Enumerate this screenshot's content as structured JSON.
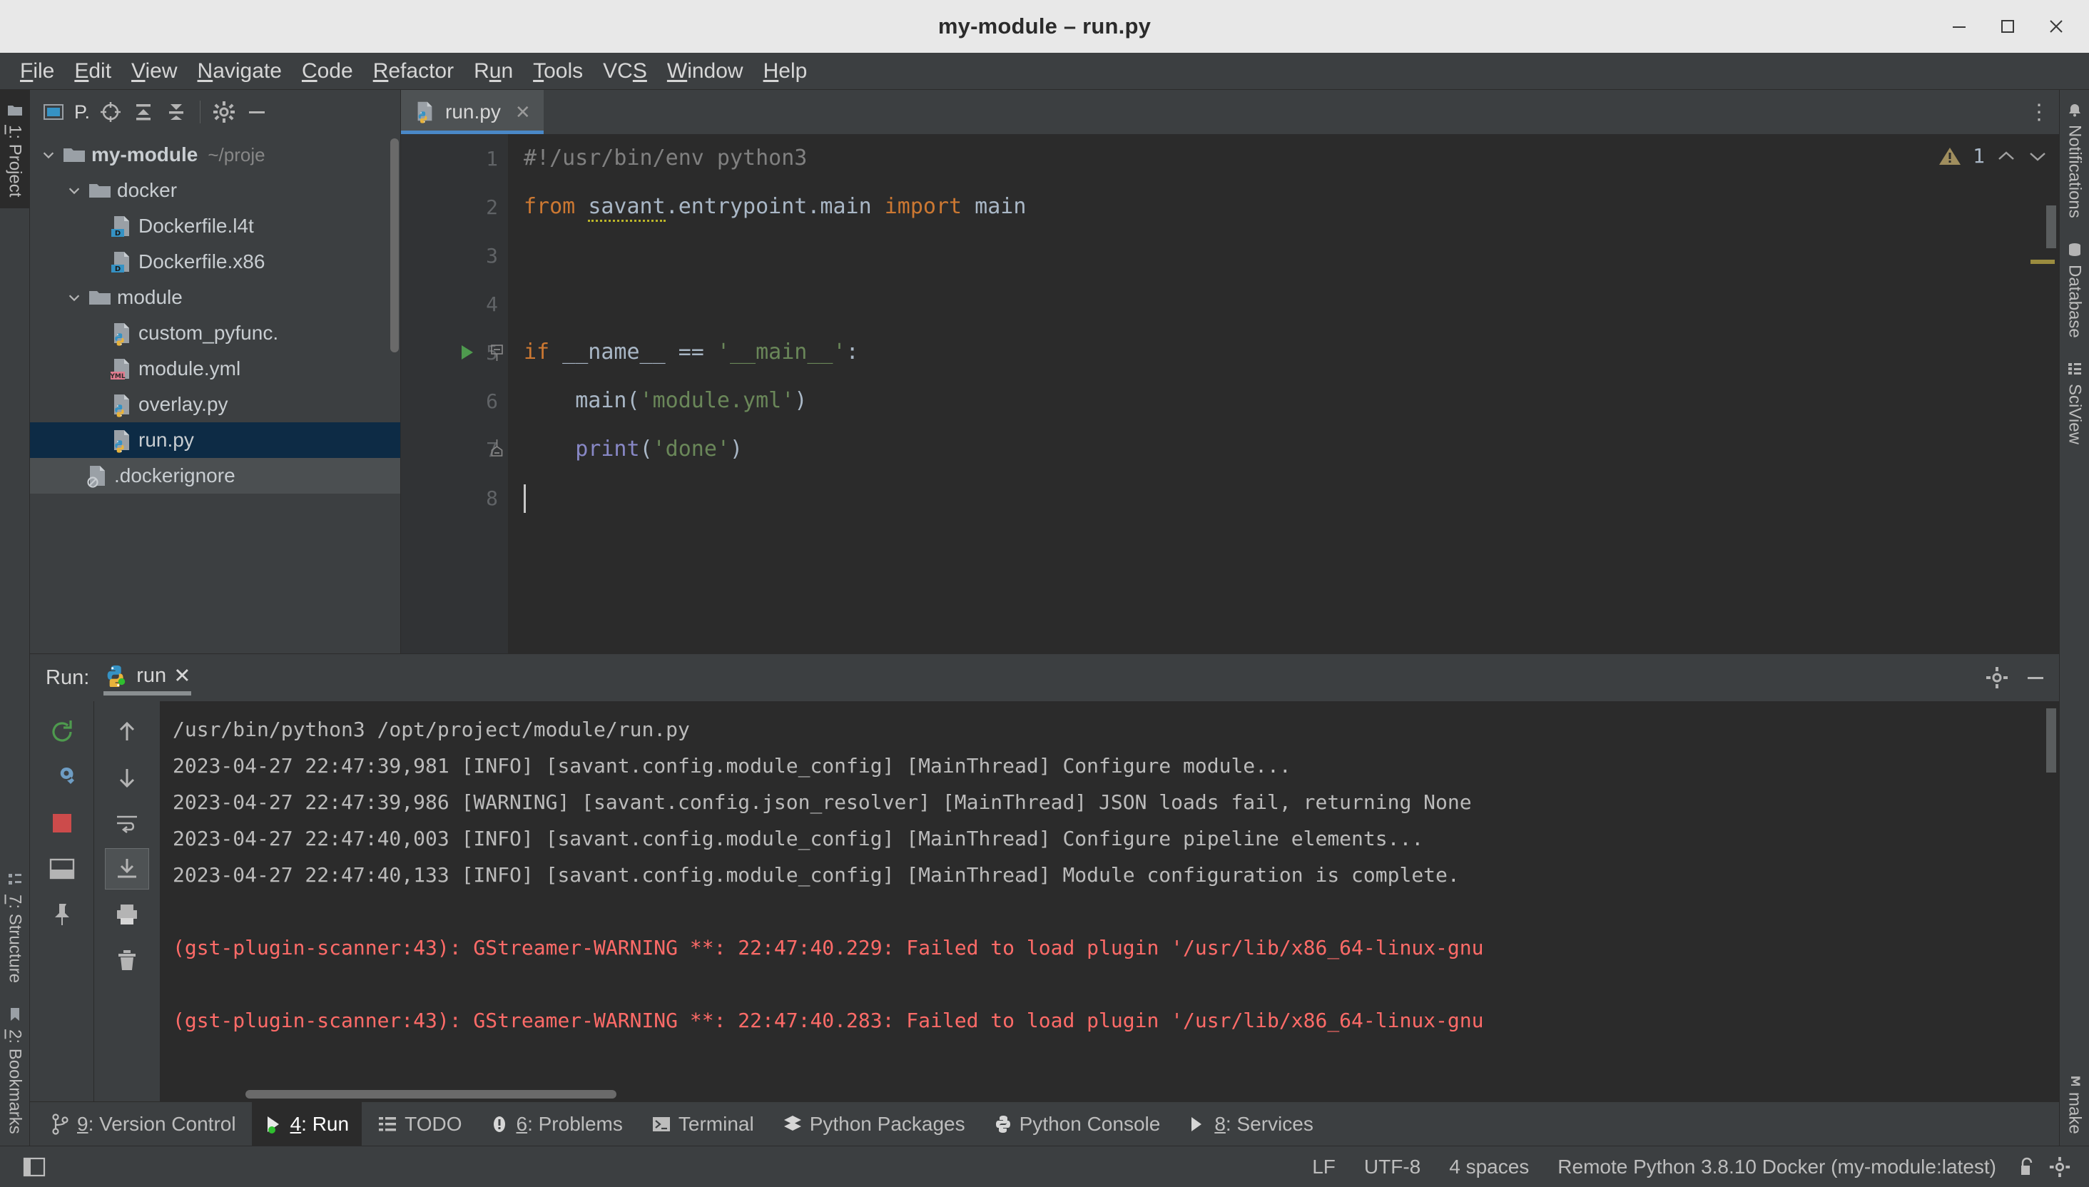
{
  "window": {
    "title": "my-module – run.py",
    "minimize_label": "—",
    "maximize_label": "❐",
    "close_label": "✕"
  },
  "menubar": {
    "items": [
      {
        "label": "File",
        "mnemonic": "F"
      },
      {
        "label": "Edit",
        "mnemonic": "E"
      },
      {
        "label": "View",
        "mnemonic": "V"
      },
      {
        "label": "Navigate",
        "mnemonic": "N"
      },
      {
        "label": "Code",
        "mnemonic": "C"
      },
      {
        "label": "Refactor",
        "mnemonic": "R"
      },
      {
        "label": "Run",
        "mnemonic": "u"
      },
      {
        "label": "Tools",
        "mnemonic": "T"
      },
      {
        "label": "VCS",
        "mnemonic": "S"
      },
      {
        "label": "Window",
        "mnemonic": "W"
      },
      {
        "label": "Help",
        "mnemonic": "H"
      }
    ]
  },
  "left_stripe": {
    "top": [
      {
        "label": "1: Project",
        "icon": "project-folder-icon",
        "active": true
      }
    ],
    "bottom": [
      {
        "label": "7: Structure",
        "icon": "structure-icon",
        "active": false
      },
      {
        "label": "2: Bookmarks",
        "icon": "bookmark-icon",
        "active": false
      }
    ]
  },
  "right_stripe": {
    "top": [
      {
        "label": "Notifications",
        "icon": "bell-icon"
      },
      {
        "label": "Database",
        "icon": "database-icon"
      },
      {
        "label": "SciView",
        "icon": "sciview-icon"
      }
    ],
    "bottom": [
      {
        "label": "make",
        "icon": "make-icon"
      }
    ]
  },
  "project_panel": {
    "title": "P.",
    "toolbar": [
      {
        "name": "select-opened-file-icon",
        "tooltip": "Select Opened File"
      },
      {
        "name": "collapse-all-icon",
        "tooltip": "Expand All"
      },
      {
        "name": "expand-all-icon",
        "tooltip": "Collapse All"
      },
      {
        "name": "settings-gear-icon",
        "tooltip": "Options"
      },
      {
        "name": "hide-icon",
        "tooltip": "Hide"
      }
    ],
    "tree": [
      {
        "label": "my-module",
        "path": "~/proje",
        "icon": "folder-icon",
        "indent": 0,
        "expanded": true,
        "bold": true,
        "state": "normal"
      },
      {
        "label": "docker",
        "path": "",
        "icon": "folder-icon",
        "indent": 1,
        "expanded": true,
        "bold": false,
        "state": "normal"
      },
      {
        "label": "Dockerfile.l4t",
        "path": "",
        "icon": "dockerfile-icon",
        "indent": 2,
        "expanded": null,
        "bold": false,
        "state": "normal"
      },
      {
        "label": "Dockerfile.x86",
        "path": "",
        "icon": "dockerfile-icon",
        "indent": 2,
        "expanded": null,
        "bold": false,
        "state": "normal"
      },
      {
        "label": "module",
        "path": "",
        "icon": "folder-icon",
        "indent": 1,
        "expanded": true,
        "bold": false,
        "state": "normal"
      },
      {
        "label": "custom_pyfunc.",
        "path": "",
        "icon": "python-file-icon",
        "indent": 2,
        "expanded": null,
        "bold": false,
        "state": "normal"
      },
      {
        "label": "module.yml",
        "path": "",
        "icon": "yml-file-icon",
        "indent": 2,
        "expanded": null,
        "bold": false,
        "state": "normal"
      },
      {
        "label": "overlay.py",
        "path": "",
        "icon": "python-file-icon",
        "indent": 2,
        "expanded": null,
        "bold": false,
        "state": "normal"
      },
      {
        "label": "run.py",
        "path": "",
        "icon": "python-file-icon",
        "indent": 2,
        "expanded": null,
        "bold": false,
        "state": "selected"
      },
      {
        "label": ".dockerignore",
        "path": "",
        "icon": "ignore-file-icon",
        "indent": 1,
        "expanded": null,
        "bold": false,
        "state": "hovered"
      }
    ]
  },
  "editor": {
    "tab": {
      "label": "run.py",
      "icon": "python-file-icon",
      "close": "✕"
    },
    "more_label": "⋮",
    "warning_count": "1",
    "warning_up": "⌃",
    "warning_down": "⌄",
    "lines": [
      {
        "num": "1",
        "marker": "none"
      },
      {
        "num": "2",
        "marker": "none"
      },
      {
        "num": "3",
        "marker": "none"
      },
      {
        "num": "4",
        "marker": "none"
      },
      {
        "num": "5",
        "marker": "run"
      },
      {
        "num": "6",
        "marker": "none"
      },
      {
        "num": "7",
        "marker": "fold-end"
      },
      {
        "num": "8",
        "marker": "none"
      }
    ],
    "code": {
      "l1_comment": "#!/usr/bin/env python3",
      "l2_kw_from": "from",
      "l2_mod": "savant",
      "l2_rest": ".entrypoint.main ",
      "l2_kw_import": "import",
      "l2_name": " main",
      "l5_kw_if": "if",
      "l5_name": " __name__ == ",
      "l5_str": "'__main__'",
      "l5_colon": ":",
      "l6_fn": "main",
      "l6_open": "(",
      "l6_str": "'module.yml'",
      "l6_close": ")",
      "l7_fn": "print",
      "l7_open": "(",
      "l7_str": "'done'",
      "l7_close": ")"
    }
  },
  "run_panel": {
    "label": "Run:",
    "tab_label": "run",
    "tab_icon": "python-run-icon",
    "tab_close": "✕",
    "settings_icon": "settings-gear-icon",
    "minimize_icon": "minimize-icon",
    "toolbar_left": [
      {
        "name": "rerun-icon",
        "tooltip": "Rerun"
      },
      {
        "name": "wrench-icon",
        "tooltip": "Modify Run Configuration"
      },
      {
        "name": "stop-icon",
        "tooltip": "Stop"
      },
      {
        "name": "layout-icon",
        "tooltip": "Layout Settings"
      },
      {
        "name": "pin-icon",
        "tooltip": "Pin Tab"
      }
    ],
    "toolbar_right": [
      {
        "name": "arrow-up-icon",
        "tooltip": "Up the Stack Trace"
      },
      {
        "name": "arrow-down-icon",
        "tooltip": "Down the Stack Trace"
      },
      {
        "name": "soft-wrap-icon",
        "tooltip": "Soft-Wrap"
      },
      {
        "name": "scroll-to-end-icon",
        "tooltip": "Scroll to End"
      },
      {
        "name": "print-icon",
        "tooltip": "Print"
      },
      {
        "name": "trash-icon",
        "tooltip": "Clear All"
      }
    ],
    "console": [
      {
        "text": "/usr/bin/python3 /opt/project/module/run.py",
        "color": "normal"
      },
      {
        "text": "2023-04-27 22:47:39,981 [INFO] [savant.config.module_config] [MainThread] Configure module...",
        "color": "normal"
      },
      {
        "text": "2023-04-27 22:47:39,986 [WARNING] [savant.config.json_resolver] [MainThread] JSON loads fail, returning None",
        "color": "normal"
      },
      {
        "text": "2023-04-27 22:47:40,003 [INFO] [savant.config.module_config] [MainThread] Configure pipeline elements...",
        "color": "normal"
      },
      {
        "text": "2023-04-27 22:47:40,133 [INFO] [savant.config.module_config] [MainThread] Module configuration is complete.",
        "color": "normal"
      },
      {
        "text": "",
        "color": "normal"
      },
      {
        "text": "(gst-plugin-scanner:43): GStreamer-WARNING **: 22:47:40.229: Failed to load plugin '/usr/lib/x86_64-linux-gnu",
        "color": "red"
      },
      {
        "text": "",
        "color": "normal"
      },
      {
        "text": "(gst-plugin-scanner:43): GStreamer-WARNING **: 22:47:40.283: Failed to load plugin '/usr/lib/x86_64-linux-gnu",
        "color": "red"
      }
    ]
  },
  "bottom_bar": {
    "tabs": [
      {
        "label": "9: Version Control",
        "mnemonic": "9",
        "icon": "vcs-branch-icon",
        "active": false
      },
      {
        "label": "4: Run",
        "mnemonic": "4",
        "icon": "run-play-icon",
        "active": true
      },
      {
        "label": "TODO",
        "mnemonic": "",
        "icon": "todo-list-icon",
        "active": false
      },
      {
        "label": "6: Problems",
        "mnemonic": "6",
        "icon": "problems-icon",
        "active": false
      },
      {
        "label": "Terminal",
        "mnemonic": "",
        "icon": "terminal-icon",
        "active": false
      },
      {
        "label": "Python Packages",
        "mnemonic": "",
        "icon": "packages-icon",
        "active": false
      },
      {
        "label": "Python Console",
        "mnemonic": "",
        "icon": "python-console-icon",
        "active": false
      },
      {
        "label": "8: Services",
        "mnemonic": "8",
        "icon": "services-icon",
        "active": false
      }
    ]
  },
  "status_bar": {
    "left_icon": "layout-toggle-icon",
    "line_separator": "LF",
    "encoding": "UTF-8",
    "indent": "4 spaces",
    "interpreter": "Remote Python 3.8.10 Docker (my-module:latest)",
    "lock_icon": "unlock-icon",
    "settings_icon": "settings-gear-icon"
  },
  "colors": {
    "accent_blue": "#4a88c7",
    "selection_blue": "#0d2b45",
    "panel_bg": "#3c3f41",
    "editor_bg": "#2b2b2b",
    "error_red": "#ff6b68",
    "keyword_orange": "#cc7832",
    "string_green": "#6a8759"
  }
}
